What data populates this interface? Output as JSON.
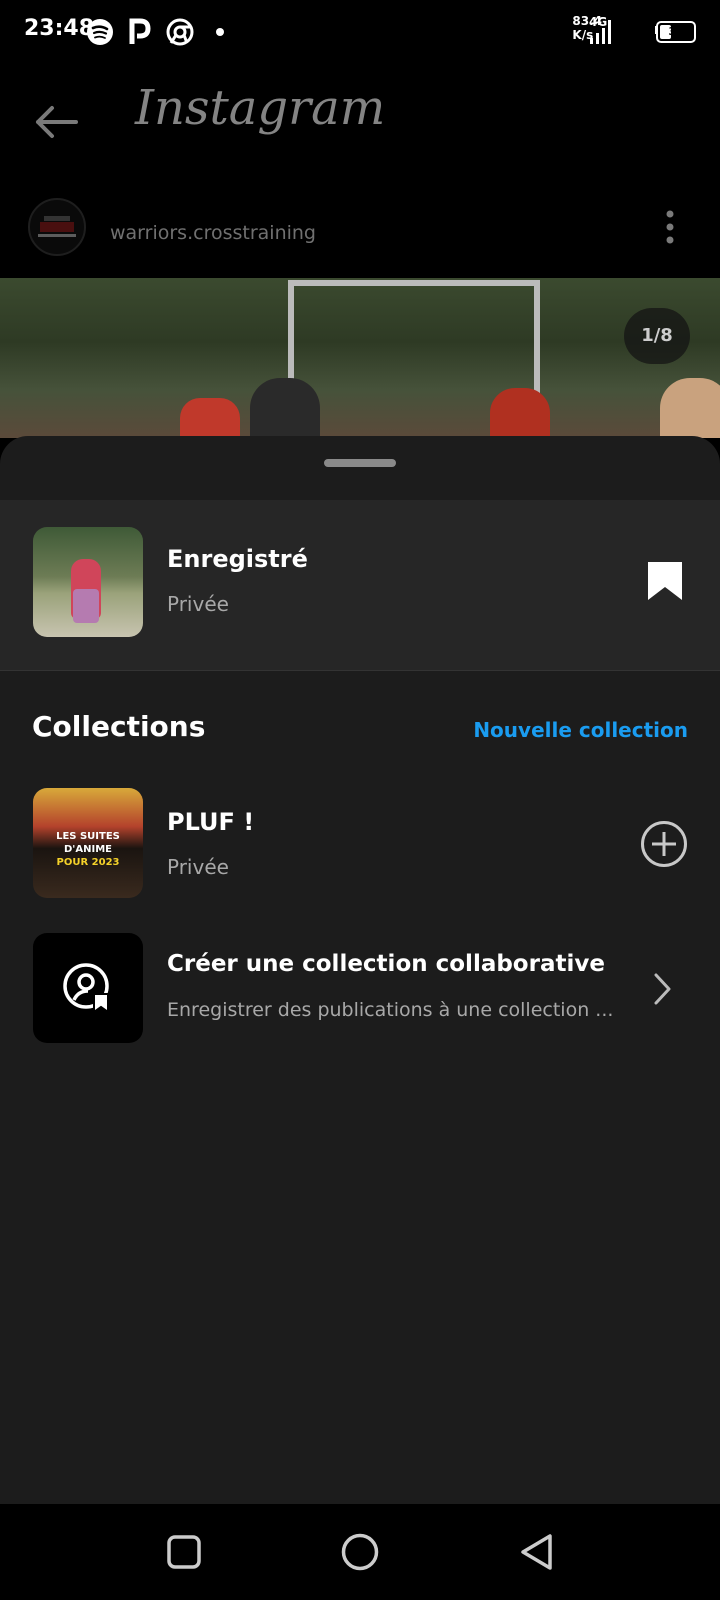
{
  "status_bar": {
    "time": "23:48",
    "network_type": "4G",
    "speed_value": "83.4",
    "speed_unit": "K/s",
    "battery_percent": "39",
    "battery_level": 0.39
  },
  "header": {
    "brand": "Instagram"
  },
  "post": {
    "username": "warriors.crosstraining",
    "counter": "1/8"
  },
  "sheet": {
    "saved": {
      "title": "Enregistré",
      "subtitle": "Privée"
    },
    "collections_heading": "Collections",
    "new_collection_label": "Nouvelle collection",
    "collections": [
      {
        "title": "PLUF !",
        "subtitle": "Privée",
        "thumb_caption_line1": "LES SUITES D'ANIME",
        "thumb_caption_line2": "POUR 2023"
      }
    ],
    "collaborative": {
      "title": "Créer une collection collaborative",
      "subtitle": "Enregistrer des publications à une collection ..."
    }
  },
  "colors": {
    "accent": "#1a9cf0",
    "sheet_bg": "#1c1c1c",
    "saved_bg": "#262626"
  }
}
